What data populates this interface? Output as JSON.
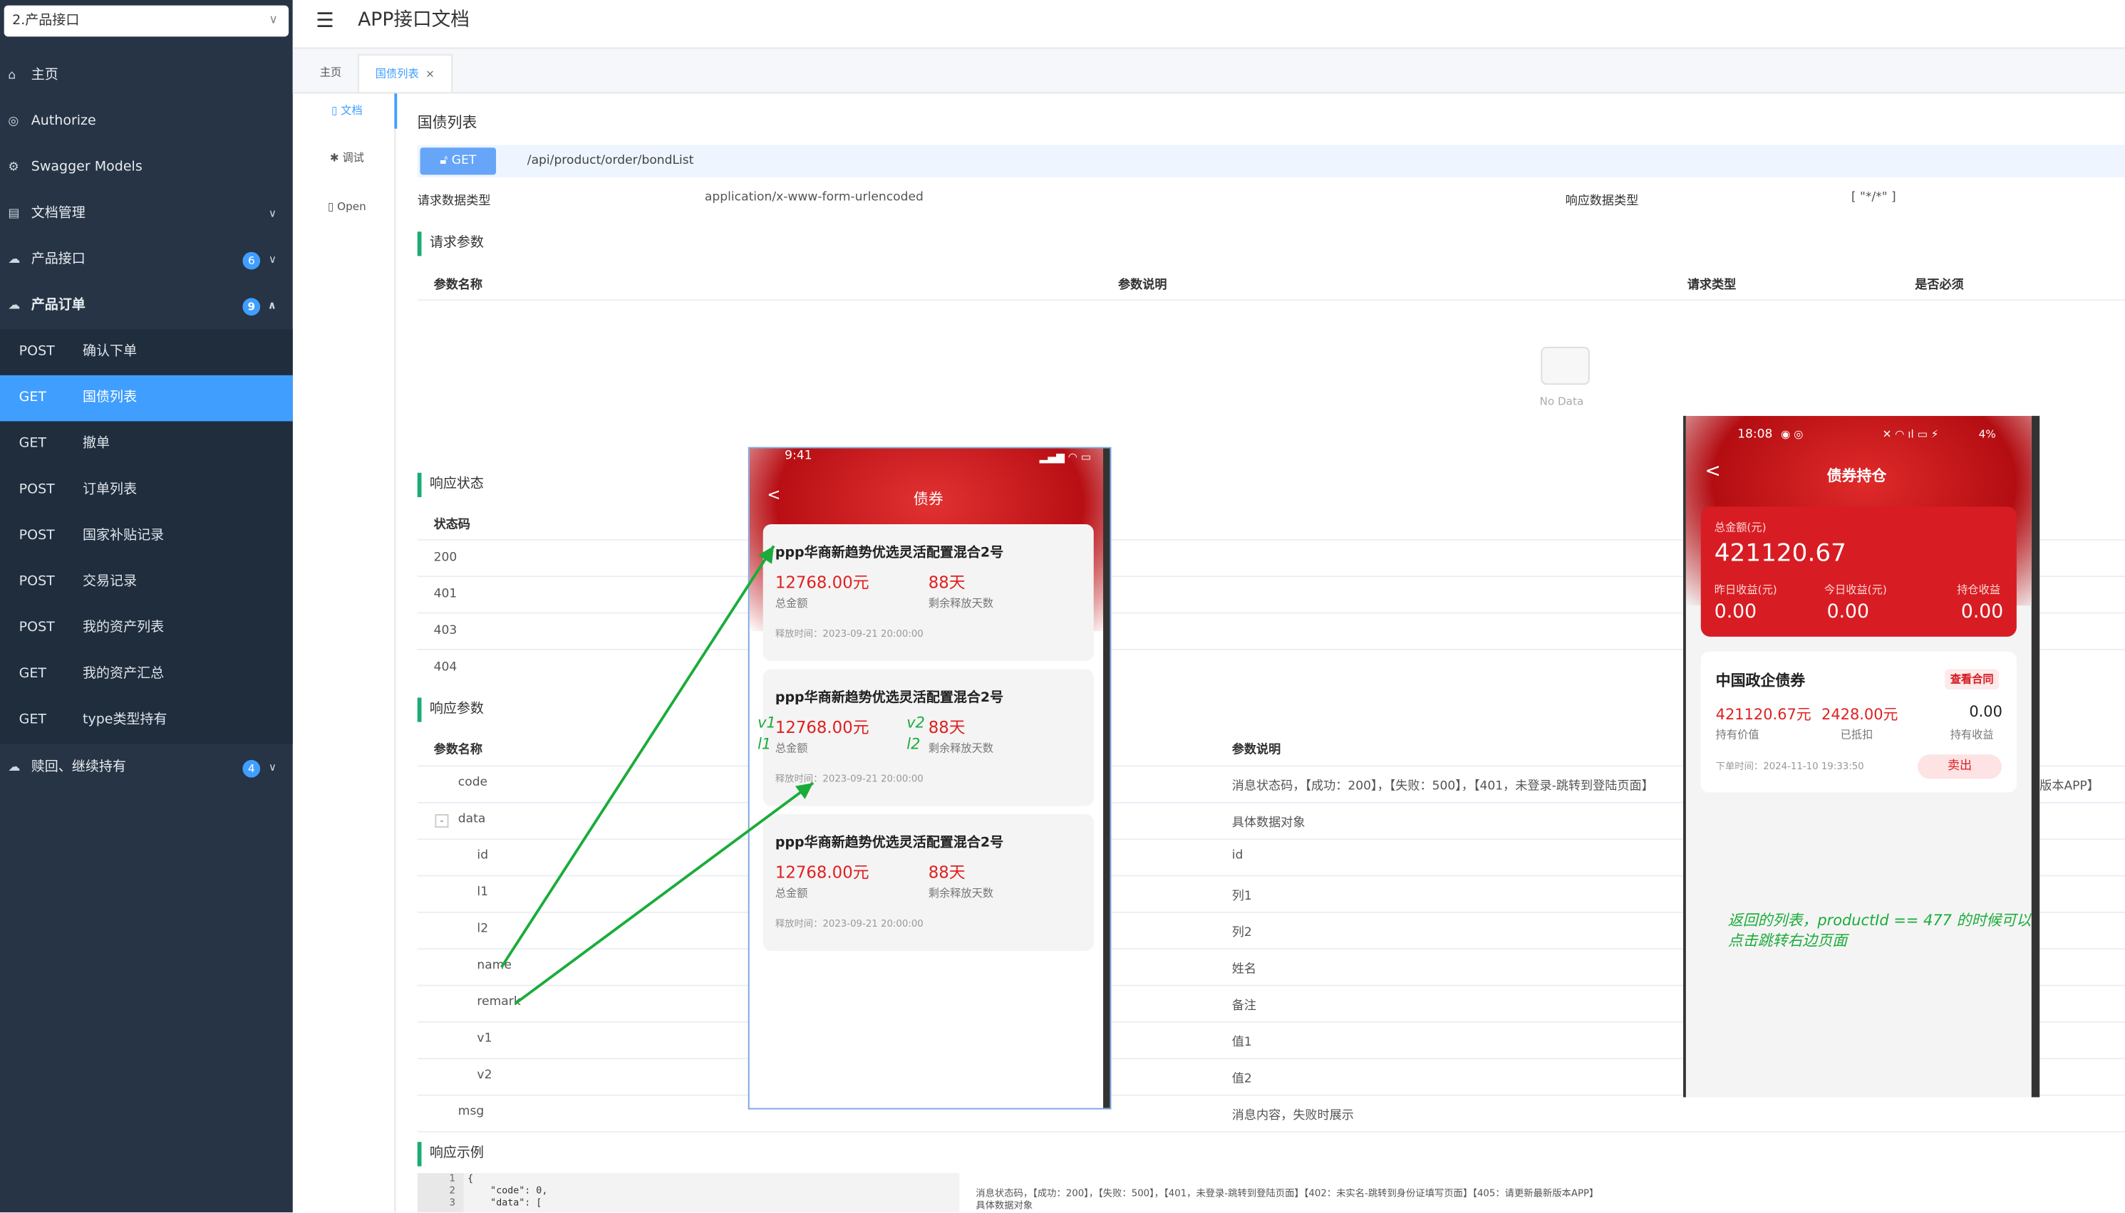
{
  "project_select": "2.产品接口",
  "nav": {
    "items": [
      {
        "label": "主页",
        "icon": "home-icon"
      },
      {
        "label": "Authorize",
        "icon": "lock-icon"
      },
      {
        "label": "Swagger Models",
        "icon": "settings-icon"
      },
      {
        "label": "文档管理",
        "icon": "document-icon"
      },
      {
        "label": "产品接口",
        "badge": "6",
        "icon": "cloud-icon"
      },
      {
        "label": "产品订单",
        "badge": "9",
        "icon": "cloud-icon"
      },
      {
        "label": "赎回、继续持有",
        "badge": "4",
        "icon": "cloud-icon"
      }
    ],
    "sub": [
      {
        "method": "POST",
        "label": "确认下单"
      },
      {
        "method": "GET",
        "label": "国债列表"
      },
      {
        "method": "GET",
        "label": "撤单"
      },
      {
        "method": "POST",
        "label": "订单列表"
      },
      {
        "method": "POST",
        "label": "国家补贴记录"
      },
      {
        "method": "POST",
        "label": "交易记录"
      },
      {
        "method": "POST",
        "label": "我的资产列表"
      },
      {
        "method": "GET",
        "label": "我的资产汇总"
      },
      {
        "method": "GET",
        "label": "type类型持有"
      }
    ]
  },
  "header": {
    "title": "APP接口文档"
  },
  "tabs": {
    "home": "主页",
    "current": "国债列表",
    "close": "×"
  },
  "sidetabs": {
    "doc": "文档",
    "debug": "调试",
    "open": "Open"
  },
  "doc": {
    "name": "国债列表",
    "method": "GET",
    "path": "/api/product/order/bondList",
    "req_type_label": "请求数据类型",
    "req_type": "application/x-www-form-urlencoded",
    "resp_type_label": "响应数据类型",
    "resp_type": "[ \"*/*\" ]",
    "req_params_title": "请求参数",
    "req_cols": [
      "参数名称",
      "参数说明",
      "请求类型",
      "是否必须"
    ],
    "no_data": "No Data",
    "status_title": "响应状态",
    "status_col": "状态码",
    "status_codes": [
      "200",
      "401",
      "403",
      "404"
    ],
    "resp_params_title": "响应参数",
    "resp_cols": [
      "参数名称",
      "参数说明"
    ],
    "resp_rows": [
      {
        "name": "code",
        "desc": "消息状态码，【成功：200】，【失败：500】，【401，未登录-跳转到登陆页面】"
      },
      {
        "name": "data",
        "desc": "具体数据对象",
        "toggle": "-"
      },
      {
        "name": "id",
        "desc": "id"
      },
      {
        "name": "l1",
        "desc": "列1"
      },
      {
        "name": "l2",
        "desc": "列2"
      },
      {
        "name": "name",
        "desc": "姓名"
      },
      {
        "name": "remark",
        "desc": "备注"
      },
      {
        "name": "v1",
        "desc": "值1"
      },
      {
        "name": "v2",
        "desc": "值2"
      },
      {
        "name": "msg",
        "desc": "消息内容，失败时展示"
      }
    ],
    "code_desc_tail": "版本APP】",
    "example_title": "响应示例",
    "code_lines": [
      "1",
      "2",
      "3"
    ],
    "code_text": "{\n    \"code\": 0,\n    \"data\": [",
    "example_desc1": "消息状态码，【成功：200】，【失败：500】，【401，未登录-跳转到登陆页面】【402：未实名-跳转到身份证填写页面】【405：请更新最新版本APP】",
    "example_desc2": "具体数据对象"
  },
  "phone1": {
    "time": "9:41",
    "title": "债券",
    "back": "<",
    "cards": [
      {
        "name": "ppp华商新趋势优选灵活配置混合2号",
        "amount": "12768.00元",
        "amount_label": "总金额",
        "days": "88天",
        "days_label": "剩余释放天数",
        "release": "释放时间：2023-09-21 20:00:00"
      },
      {
        "name": "ppp华商新趋势优选灵活配置混合2号",
        "amount": "12768.00元",
        "amount_label": "总金额",
        "days": "88天",
        "days_label": "剩余释放天数",
        "release": "释放时间：2023-09-21 20:00:00",
        "ann": {
          "v1": "v1",
          "l1": "l1",
          "v2": "v2",
          "l2": "l2"
        }
      },
      {
        "name": "ppp华商新趋势优选灵活配置混合2号",
        "amount": "12768.00元",
        "amount_label": "总金额",
        "days": "88天",
        "days_label": "剩余释放天数",
        "release": "释放时间：2023-09-21 20:00:00"
      }
    ]
  },
  "phone2": {
    "time": "18:08",
    "battery": "4%",
    "title": "债券持仓",
    "back": "<",
    "total_label": "总金额(元)",
    "total": "421120.67",
    "stats": [
      {
        "label": "昨日收益(元)",
        "value": "0.00"
      },
      {
        "label": "今日收益(元)",
        "value": "0.00"
      },
      {
        "label": "持仓收益",
        "value": "0.00"
      }
    ],
    "holding": {
      "name": "中国政企债券",
      "contract": "查看合同",
      "value": "421120.67元",
      "value_label": "持有价值",
      "deducted": "2428.00元",
      "deducted_label": "已抵扣",
      "income": "0.00",
      "income_label": "持有收益",
      "order_time": "下单时间：2024-11-10 19:33:50",
      "sell": "卖出"
    }
  },
  "annotation_note": [
    "返回的列表，productId == 477 的时候可以点击",
    "点击跳转右边页面"
  ],
  "colors": {
    "accent": "#409eff",
    "sidebar": "#263445",
    "red": "#e02020",
    "green": "#1aac3a"
  }
}
